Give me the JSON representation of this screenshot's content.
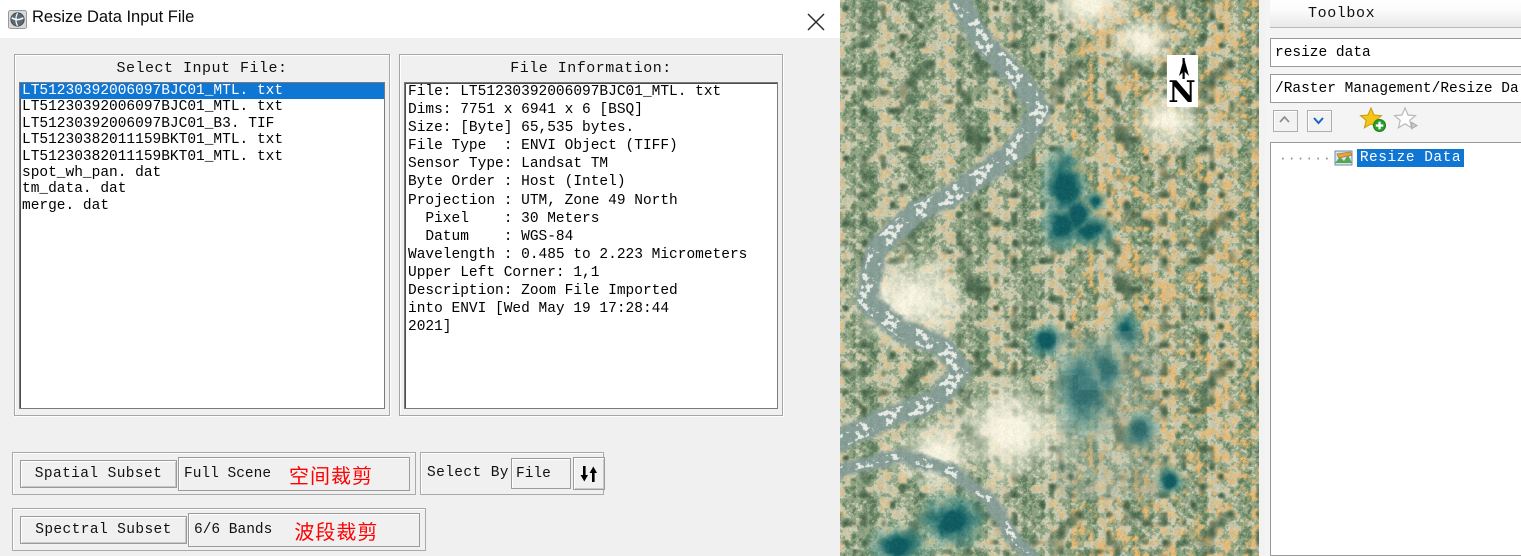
{
  "dialog": {
    "title": "Resize Data Input File",
    "icon": "envi-app-icon",
    "close_label": "×"
  },
  "select_input": {
    "title": "Select Input File:",
    "files": [
      "LT51230392006097BJC01_MTL. txt",
      "LT51230392006097BJC01_MTL. txt",
      "LT51230392006097BJC01_B3. TIF",
      "LT51230382011159BKT01_MTL. txt",
      "LT51230382011159BKT01_MTL. txt",
      "spot_wh_pan. dat",
      "tm_data. dat",
      "merge. dat"
    ],
    "selected_index": 0
  },
  "file_information": {
    "title": "File Information:",
    "lines": [
      "File: LT51230392006097BJC01_MTL. txt",
      "Dims: 7751 x 6941 x 6 [BSQ]",
      "Size: [Byte] 65,535 bytes.",
      "File Type  : ENVI Object (TIFF)",
      "Sensor Type: Landsat TM",
      "Byte Order : Host (Intel)",
      "Projection : UTM, Zone 49 North",
      "  Pixel    : 30 Meters",
      "  Datum    : WGS-84",
      "Wavelength : 0.485 to 2.223 Micrometers",
      "Upper Left Corner: 1,1",
      "Description: Zoom File Imported",
      "into ENVI [Wed May 19 17:28:44",
      "2021]"
    ]
  },
  "controls": {
    "spatial_subset_button": "Spatial Subset",
    "spatial_subset_value": "Full Scene",
    "spatial_subset_note": "空间裁剪",
    "select_by_label": "Select By",
    "select_by_value": "File",
    "sort_toggle_icon": "sort-updown-icon",
    "spectral_subset_button": "Spectral Subset",
    "spectral_subset_value": "6/6 Bands",
    "spectral_subset_note": "波段裁剪"
  },
  "toolbox": {
    "header": "Toolbox",
    "search_value": "resize data",
    "path_value": "/Raster Management/Resize Da",
    "toolbar": {
      "up_icon": "chevron-up-icon",
      "down_icon": "chevron-down-icon",
      "add_favorite_icon": "star-add-icon",
      "remove_favorite_icon": "star-remove-icon"
    },
    "tree": {
      "item_label": "Resize Data",
      "item_icon": "resize-data-icon",
      "selected": true
    }
  },
  "image_view": {
    "name": "landsat-satellite-image",
    "north_arrow": "N"
  },
  "colors": {
    "selection_blue": "#1076d4",
    "annotation_red": "#ff0000",
    "dialog_bg": "#f0f0f0",
    "titlebar_bg": "#ffffff"
  }
}
